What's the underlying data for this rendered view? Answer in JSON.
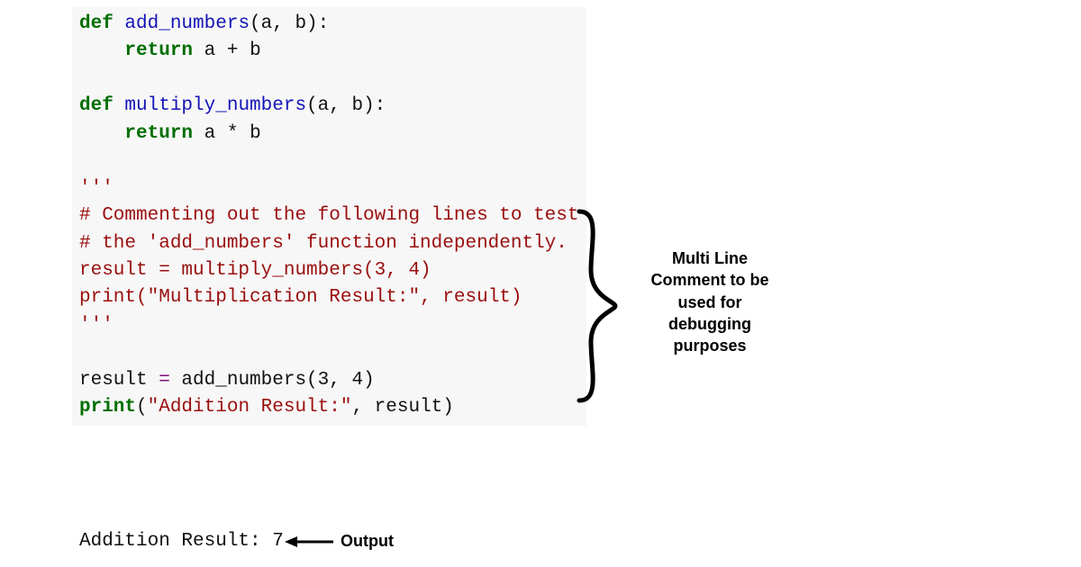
{
  "code": {
    "l1_def": "def",
    "l1_fn": "add_numbers",
    "l1_rest": "(a, b):",
    "l2_ret": "return",
    "l2_expr": "a + b",
    "l4_def": "def",
    "l4_fn": "multiply_numbers",
    "l4_rest": "(a, b):",
    "l5_ret": "return",
    "l5_expr": "a * b",
    "l7_triple": "'''",
    "l8_comment": "# Commenting out the following lines to test",
    "l9_comment": "# the 'add_numbers' function independently.",
    "l10_code": "result = multiply_numbers(3, 4)",
    "l11_print": "print(",
    "l11_str": "\"Multiplication Result:\"",
    "l11_rest": ", result)",
    "l12_triple": "'''",
    "l14_lhs": "result ",
    "l14_eq": "=",
    "l14_rhs": " add_numbers(",
    "l14_args": "3",
    "l14_comma": ", ",
    "l14_arg2": "4",
    "l14_close": ")",
    "l15_print": "print",
    "l15_open": "(",
    "l15_str": "\"Addition Result:\"",
    "l15_rest": ", result)"
  },
  "output": {
    "text": "Addition Result: 7",
    "label": "Output"
  },
  "annotation": {
    "line1": "Multi Line",
    "line2": "Comment to be",
    "line3": "used for",
    "line4": "debugging",
    "line5": "purposes"
  }
}
